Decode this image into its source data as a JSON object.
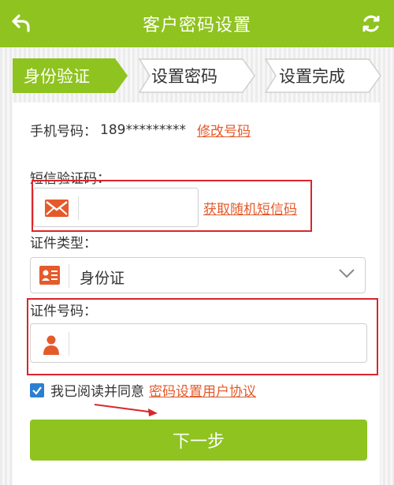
{
  "header": {
    "title": "客户密码设置",
    "back_icon": "back-arrow-icon",
    "refresh_icon": "refresh-icon"
  },
  "steps": [
    {
      "label": "身份验证",
      "active": true
    },
    {
      "label": "设置密码",
      "active": false
    },
    {
      "label": "设置完成",
      "active": false
    }
  ],
  "phone": {
    "label": "手机号码：",
    "value": "189*********",
    "change_link": "修改号码"
  },
  "sms": {
    "label": "短信验证码：",
    "value": "",
    "get_code_link": "获取随机短信码",
    "icon": "envelope-icon"
  },
  "id_type": {
    "label": "证件类型：",
    "selected": "身份证",
    "icon": "id-card-icon"
  },
  "id_number": {
    "label": "证件号码：",
    "value": "",
    "icon": "person-icon"
  },
  "agreement": {
    "checked": true,
    "text": "我已阅读并同意",
    "link": "密码设置用户协议"
  },
  "next_button": {
    "label": "下一步"
  },
  "colors": {
    "brand_green": "#8fc31f",
    "link_orange": "#e45a2b",
    "annotation_red": "#d9262b",
    "checkbox_blue": "#2b7fd3"
  }
}
